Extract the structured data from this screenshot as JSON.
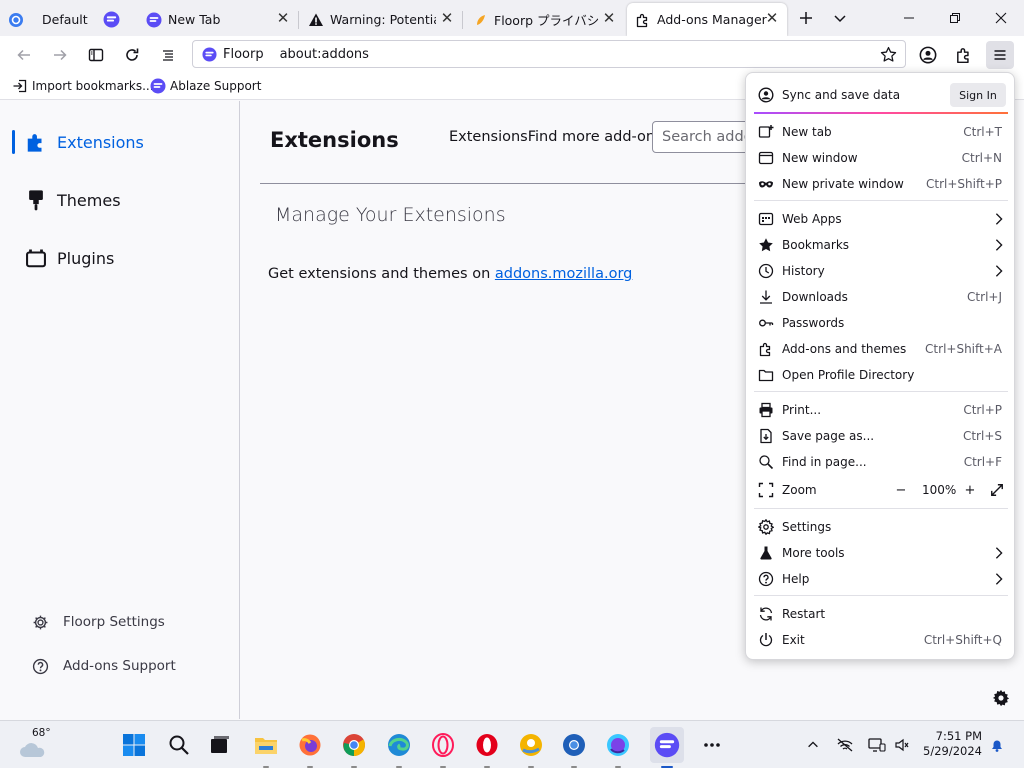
{
  "tabs": [
    {
      "title": "Default"
    },
    {
      "title": "New Tab"
    },
    {
      "title": "Warning: Potential S"
    },
    {
      "title": "Floorp プライバシー"
    },
    {
      "title": "Add-ons Manager"
    }
  ],
  "urlbar": {
    "identity": "Floorp",
    "url": "about:addons"
  },
  "bookmarks": [
    {
      "label": "Import bookmarks..."
    },
    {
      "label": "Ablaze Support"
    }
  ],
  "sidebar": {
    "categories": [
      {
        "label": "Extensions",
        "icon": "puzzle-icon"
      },
      {
        "label": "Themes",
        "icon": "brush-icon"
      },
      {
        "label": "Plugins",
        "icon": "plugin-icon"
      }
    ],
    "footer": [
      {
        "label": "Floorp Settings",
        "icon": "gear-icon"
      },
      {
        "label": "Add-ons Support",
        "icon": "help-icon"
      }
    ]
  },
  "main": {
    "heading": "Extensions",
    "find_more": "ExtensionsFind more add-ons",
    "search_placeholder": "Search addons.mozilla.org",
    "manage_heading": "Manage Your Extensions",
    "get_text": "Get extensions and themes on ",
    "get_link": "addons.mozilla.org"
  },
  "menu": {
    "sync_label": "Sync and save data",
    "sign_in": "Sign In",
    "groups": [
      [
        {
          "label": "New tab",
          "shortcut": "Ctrl+T",
          "icon": "new-tab-icon"
        },
        {
          "label": "New window",
          "shortcut": "Ctrl+N",
          "icon": "new-window-icon"
        },
        {
          "label": "New private window",
          "shortcut": "Ctrl+Shift+P",
          "icon": "private-mask-icon"
        }
      ],
      [
        {
          "label": "Web Apps",
          "submenu": true,
          "icon": "web-apps-icon"
        },
        {
          "label": "Bookmarks",
          "submenu": true,
          "icon": "star-icon"
        },
        {
          "label": "History",
          "submenu": true,
          "icon": "clock-icon"
        },
        {
          "label": "Downloads",
          "shortcut": "Ctrl+J",
          "icon": "download-icon"
        },
        {
          "label": "Passwords",
          "icon": "key-icon"
        },
        {
          "label": "Add-ons and themes",
          "shortcut": "Ctrl+Shift+A",
          "icon": "puzzle-icon"
        },
        {
          "label": "Open Profile Directory",
          "icon": "folder-icon"
        }
      ],
      [
        {
          "label": "Print...",
          "shortcut": "Ctrl+P",
          "icon": "print-icon"
        },
        {
          "label": "Save page as...",
          "shortcut": "Ctrl+S",
          "icon": "save-page-icon"
        },
        {
          "label": "Find in page...",
          "shortcut": "Ctrl+F",
          "icon": "search-icon"
        }
      ],
      [
        {
          "label": "Settings",
          "icon": "gear-icon"
        },
        {
          "label": "More tools",
          "submenu": true,
          "icon": "flask-icon"
        },
        {
          "label": "Help",
          "submenu": true,
          "icon": "help-icon"
        }
      ],
      [
        {
          "label": "Restart",
          "icon": "restart-icon"
        },
        {
          "label": "Exit",
          "shortcut": "Ctrl+Shift+Q",
          "icon": "power-icon"
        }
      ]
    ],
    "zoom": {
      "label": "Zoom",
      "minus": "−",
      "value": "100%",
      "plus": "+"
    }
  },
  "taskbar": {
    "weather": "68°",
    "time": "7:51 PM",
    "date": "5/29/2024",
    "apps": [
      "start-icon",
      "search-icon",
      "task-view-icon",
      "file-explorer-icon",
      "firefox-icon",
      "chrome-icon",
      "edge-icon",
      "opera-gx-icon",
      "opera-icon",
      "chrome-canary-icon",
      "chromium-icon",
      "firefox-nightly-icon",
      "floorp-icon",
      "more-icon"
    ]
  },
  "colors": {
    "accent": "#0061e0",
    "floorp": "#5b4cf5"
  }
}
